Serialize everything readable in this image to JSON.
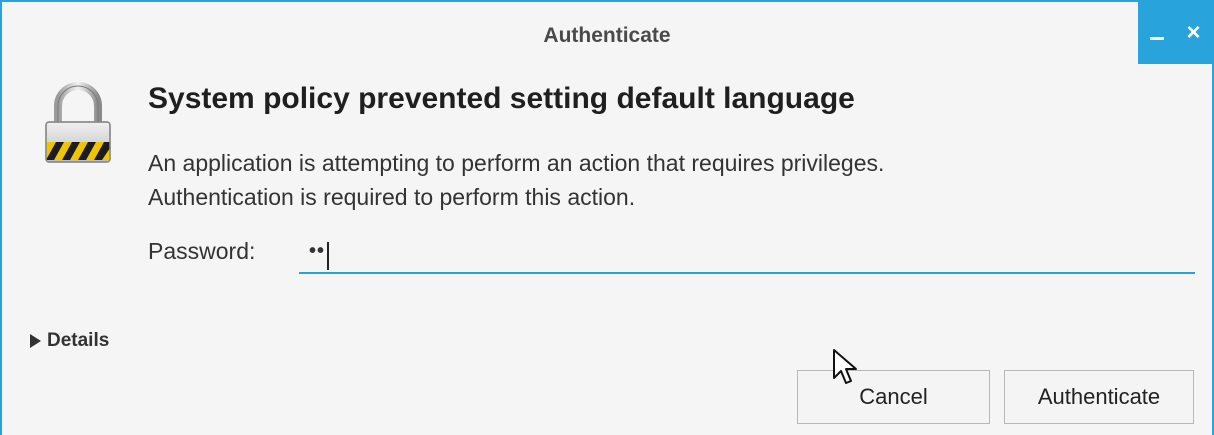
{
  "window": {
    "title": "Authenticate",
    "minimize_label": "–",
    "close_label": "×"
  },
  "dialog": {
    "heading": "System policy prevented setting default language",
    "message_line1": "An application is attempting to perform an action that requires privileges.",
    "message_line2": "Authentication is required to perform this action.",
    "password_label": "Password:",
    "password_value": "••",
    "details_label": "Details"
  },
  "buttons": {
    "cancel": "Cancel",
    "authenticate": "Authenticate"
  },
  "colors": {
    "accent": "#29a3dc"
  },
  "icons": {
    "lock": "padlock-icon",
    "expander": "triangle-right-icon",
    "cursor": "mouse-pointer-icon"
  }
}
